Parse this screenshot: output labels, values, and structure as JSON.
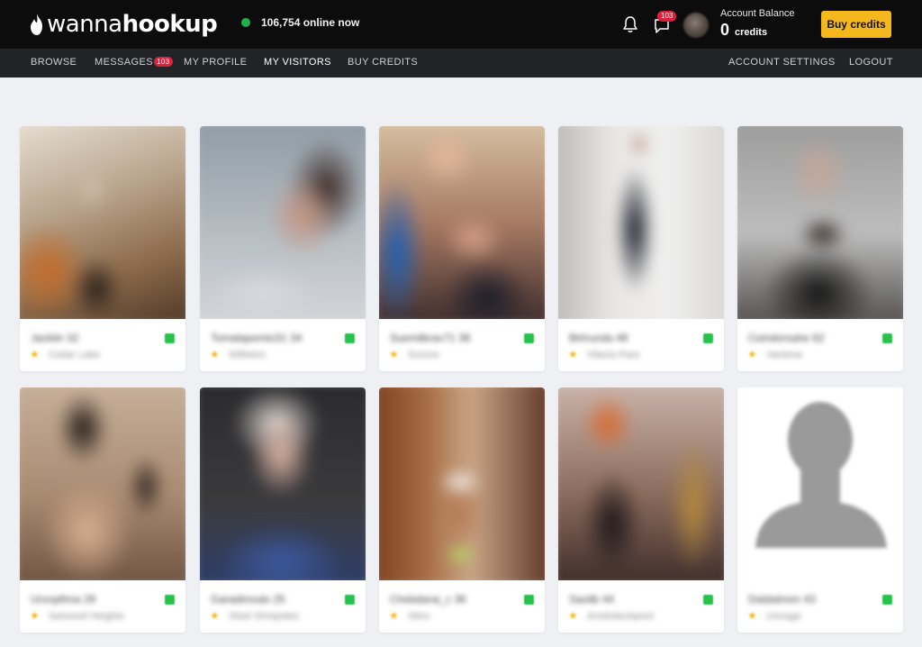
{
  "brand": {
    "logo_light": "wanna",
    "logo_bold": "hookup"
  },
  "online": {
    "text": "106,754 online now"
  },
  "header": {
    "messages_badge": "103",
    "balance_title": "Account Balance",
    "balance_value": "0",
    "balance_unit": "credits",
    "buy_button": "Buy credits"
  },
  "nav": {
    "browse": "BROWSE",
    "messages": "MESSAGES",
    "messages_badge": "103",
    "profile": "MY PROFILE",
    "visitors": "MY VISITORS",
    "buy": "BUY CREDITS",
    "settings": "ACCOUNT SETTINGS",
    "logout": "LOGOUT"
  },
  "colors": {
    "accent": "#f5b81c",
    "badge": "#e0203a",
    "online": "#1fb24a"
  },
  "cards": [
    {
      "name": "Jacklin 32",
      "location": "Cedar Lake"
    },
    {
      "name": "Tomalapemlo31 34",
      "location": "Williston"
    },
    {
      "name": "Suemilkrav71 38",
      "location": "Suncre"
    },
    {
      "name": "Birtrunda 48",
      "location": "Vilavia Pare"
    },
    {
      "name": "Ceindorsahe 62",
      "location": "Vantone"
    },
    {
      "name": "Ursnpthna 29",
      "location": "Samonel Heights"
    },
    {
      "name": "Garadimodo 25",
      "location": "Stoel Shrepsten"
    },
    {
      "name": "Chebdarai_c 36",
      "location": "Stinx"
    },
    {
      "name": "Saolib 44",
      "location": "Anolodeuhpont"
    },
    {
      "name": "Datdalmon 43",
      "location": "Unnage"
    }
  ]
}
